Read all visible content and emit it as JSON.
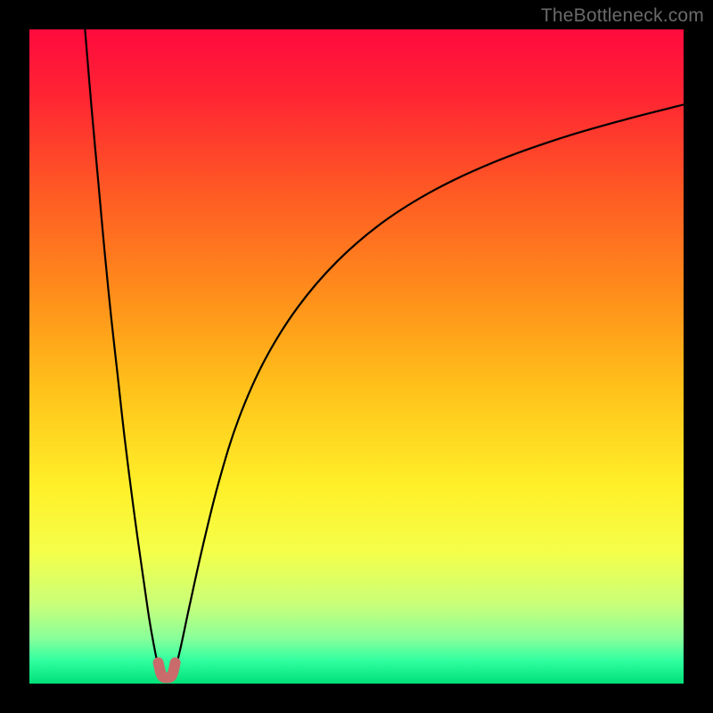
{
  "watermark": "TheBottleneck.com",
  "chart_data": {
    "type": "line",
    "title": "",
    "xlabel": "",
    "ylabel": "",
    "xlim": [
      0,
      100
    ],
    "ylim": [
      0,
      100
    ],
    "grid": false,
    "legend": false,
    "gradient_stops": [
      {
        "offset": 0.0,
        "color": "#ff0a3e"
      },
      {
        "offset": 0.1,
        "color": "#ff2433"
      },
      {
        "offset": 0.25,
        "color": "#ff5a24"
      },
      {
        "offset": 0.4,
        "color": "#ff8c1b"
      },
      {
        "offset": 0.55,
        "color": "#ffc21a"
      },
      {
        "offset": 0.7,
        "color": "#fff029"
      },
      {
        "offset": 0.8,
        "color": "#f4ff4a"
      },
      {
        "offset": 0.88,
        "color": "#c8ff7a"
      },
      {
        "offset": 0.93,
        "color": "#8aff9a"
      },
      {
        "offset": 0.965,
        "color": "#30ffa0"
      },
      {
        "offset": 1.0,
        "color": "#00e079"
      }
    ],
    "series": [
      {
        "name": "bottleneck-left",
        "stroke": "#000000",
        "stroke_width": 2.2,
        "x": [
          8.5,
          9.5,
          10.5,
          11.5,
          12.5,
          13.5,
          14.5,
          15.5,
          16.5,
          17.5,
          18.3,
          19.0,
          19.6,
          20.0
        ],
        "y": [
          100,
          88,
          77,
          66,
          56,
          47,
          38,
          30,
          22.5,
          15.5,
          10,
          6,
          3,
          1.2
        ]
      },
      {
        "name": "bottleneck-right",
        "stroke": "#000000",
        "stroke_width": 2.2,
        "x": [
          22.0,
          23.0,
          24.5,
          26.5,
          29.0,
          32.0,
          36.0,
          41.0,
          47.0,
          54.0,
          62.0,
          71.0,
          81.0,
          91.0,
          100.0
        ],
        "y": [
          1.2,
          5,
          12,
          21,
          31,
          40.5,
          49.5,
          57.5,
          64.5,
          70.5,
          75.5,
          79.7,
          83.3,
          86.2,
          88.5
        ]
      }
    ],
    "marker": {
      "name": "optimal-region",
      "color": "#c96b6b",
      "stroke_width": 12,
      "points": [
        {
          "x": 19.7,
          "y": 3.2
        },
        {
          "x": 20.2,
          "y": 1.3
        },
        {
          "x": 21.0,
          "y": 0.9
        },
        {
          "x": 21.8,
          "y": 1.3
        },
        {
          "x": 22.3,
          "y": 3.2
        }
      ]
    }
  }
}
